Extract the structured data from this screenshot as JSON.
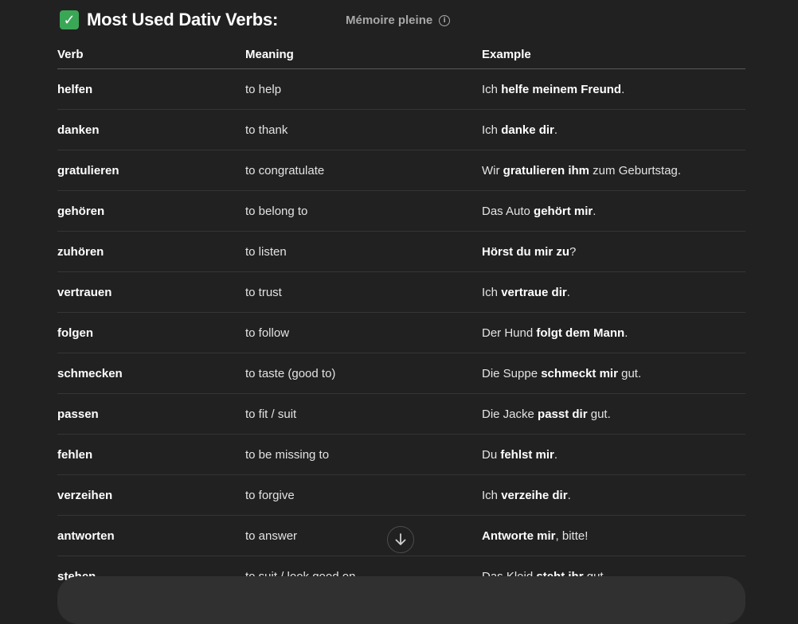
{
  "header": {
    "check_icon_glyph": "✓",
    "title": "Most Used Dativ Verbs:",
    "memory_label": "Mémoire pleine",
    "info_icon_glyph": "i"
  },
  "table": {
    "columns": [
      "Verb",
      "Meaning",
      "Example"
    ],
    "rows": [
      {
        "verb": "helfen",
        "meaning": "to help",
        "example": [
          {
            "t": "Ich ",
            "b": false
          },
          {
            "t": "helfe meinem Freund",
            "b": true
          },
          {
            "t": ".",
            "b": false
          }
        ]
      },
      {
        "verb": "danken",
        "meaning": "to thank",
        "example": [
          {
            "t": "Ich ",
            "b": false
          },
          {
            "t": "danke dir",
            "b": true
          },
          {
            "t": ".",
            "b": false
          }
        ]
      },
      {
        "verb": "gratulieren",
        "meaning": "to congratulate",
        "example": [
          {
            "t": "Wir ",
            "b": false
          },
          {
            "t": "gratulieren ihm",
            "b": true
          },
          {
            "t": " zum Geburtstag.",
            "b": false
          }
        ]
      },
      {
        "verb": "gehören",
        "meaning": "to belong to",
        "example": [
          {
            "t": "Das Auto ",
            "b": false
          },
          {
            "t": "gehört mir",
            "b": true
          },
          {
            "t": ".",
            "b": false
          }
        ]
      },
      {
        "verb": "zuhören",
        "meaning": "to listen",
        "example": [
          {
            "t": "Hörst du mir zu",
            "b": true
          },
          {
            "t": "?",
            "b": false
          }
        ]
      },
      {
        "verb": "vertrauen",
        "meaning": "to trust",
        "example": [
          {
            "t": "Ich ",
            "b": false
          },
          {
            "t": "vertraue dir",
            "b": true
          },
          {
            "t": ".",
            "b": false
          }
        ]
      },
      {
        "verb": "folgen",
        "meaning": "to follow",
        "example": [
          {
            "t": "Der Hund ",
            "b": false
          },
          {
            "t": "folgt dem Mann",
            "b": true
          },
          {
            "t": ".",
            "b": false
          }
        ]
      },
      {
        "verb": "schmecken",
        "meaning": "to taste (good to)",
        "example": [
          {
            "t": "Die Suppe ",
            "b": false
          },
          {
            "t": "schmeckt mir",
            "b": true
          },
          {
            "t": " gut.",
            "b": false
          }
        ]
      },
      {
        "verb": "passen",
        "meaning": "to fit / suit",
        "example": [
          {
            "t": "Die Jacke ",
            "b": false
          },
          {
            "t": "passt dir",
            "b": true
          },
          {
            "t": " gut.",
            "b": false
          }
        ]
      },
      {
        "verb": "fehlen",
        "meaning": "to be missing to",
        "example": [
          {
            "t": "Du ",
            "b": false
          },
          {
            "t": "fehlst mir",
            "b": true
          },
          {
            "t": ".",
            "b": false
          }
        ]
      },
      {
        "verb": "verzeihen",
        "meaning": "to forgive",
        "example": [
          {
            "t": "Ich ",
            "b": false
          },
          {
            "t": "verzeihe dir",
            "b": true
          },
          {
            "t": ".",
            "b": false
          }
        ]
      },
      {
        "verb": "antworten",
        "meaning": "to answer",
        "example": [
          {
            "t": "Antworte mir",
            "b": true
          },
          {
            "t": ", bitte!",
            "b": false
          }
        ]
      },
      {
        "verb": "stehen",
        "meaning": "to suit / look good on",
        "example": [
          {
            "t": "Das Kleid ",
            "b": false
          },
          {
            "t": "steht ihr",
            "b": true
          },
          {
            "t": " gut.",
            "b": false
          }
        ]
      }
    ]
  },
  "scroll_down": {
    "icon": "arrow-down-icon"
  },
  "composer": {
    "placeholder": ""
  },
  "colors": {
    "background": "#212121",
    "accent_check": "#3aa757",
    "composer_bg": "#303030"
  }
}
